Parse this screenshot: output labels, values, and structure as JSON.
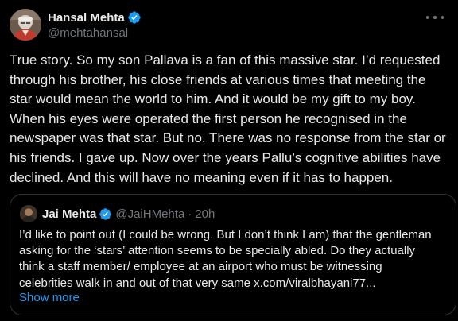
{
  "tweet": {
    "author": {
      "display_name": "Hansal Mehta",
      "handle": "@mehtahansal",
      "verified_icon": "verified-badge-icon",
      "verified_color": "#1d9bf0"
    },
    "more_icon": "more-options-icon",
    "text": "True story. So my son Pallava is a fan of this massive star. I’d requested\nthrough his brother, his close friends at various times that meeting the\nstar would mean the world to him. And it would be my gift to my boy.\nWhen his eyes were operated the first person he recognised in the\nnewspaper was that star. But no. There was no response from the star or\nhis friends. I gave up. Now over the years Pallu’s cognitive abilities have\ndeclined. And this will have no meaning even if it has to happen."
  },
  "quoted_tweet": {
    "author": {
      "display_name": "Jai Mehta",
      "handle": "@JaiHMehta",
      "separator": "·",
      "time": "20h",
      "verified_icon": "verified-badge-icon"
    },
    "text": "I’d like to point out (I could be wrong. But I don’t think I am) that the gentleman\nasking for the ‘stars’ attention seems to be specially abled. Do they actually\nthink a staff member/ employee at an airport who must be witnessing\ncelebrities walk in and out of that very same x.com/viralbhayani77...",
    "show_more_label": "Show more"
  },
  "colors": {
    "background": "#000000",
    "text_primary": "#e7e9ea",
    "text_secondary": "#71767b",
    "accent": "#1d9bf0",
    "border": "#2f3336"
  }
}
